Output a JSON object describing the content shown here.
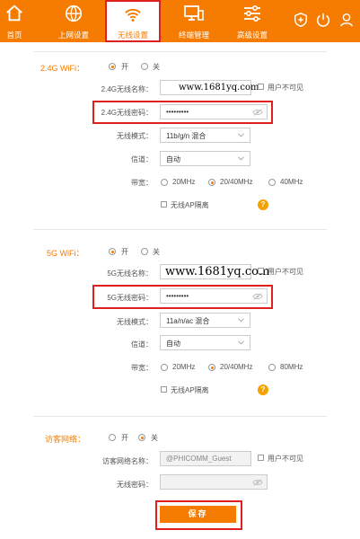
{
  "nav": {
    "items": [
      {
        "label": "首页",
        "icon": "home-icon"
      },
      {
        "label": "上网设置",
        "icon": "globe-icon"
      },
      {
        "label": "无线设置",
        "icon": "wifi-icon"
      },
      {
        "label": "终端管理",
        "icon": "devices-icon"
      },
      {
        "label": "高级设置",
        "icon": "sliders-icon"
      }
    ],
    "active": "无线设置",
    "top_icons": [
      "shield-plus-icon",
      "power-icon",
      "user-icon"
    ]
  },
  "wifi24": {
    "title": "2.4G WiFi：",
    "on_label": "开",
    "off_label": "关",
    "enabled": true,
    "name_label": "2.4G无线名称：",
    "name_value": "",
    "watermark": "www.1681yq.com",
    "hidden_label": "用户不可见",
    "pwd_label": "2.4G无线密码：",
    "pwd_value": "•••••••••",
    "mode_label": "无线模式：",
    "mode_value": "11b/g/n 混合",
    "channel_label": "信道：",
    "channel_value": "自动",
    "bw_label": "带宽：",
    "bw_options": [
      "20MHz",
      "20/40MHz",
      "40MHz"
    ],
    "bw_selected": "20/40MHz",
    "ap_isolation_label": "无线AP隔离"
  },
  "wifi5": {
    "title": "5G WiFi：",
    "on_label": "开",
    "off_label": "关",
    "enabled": true,
    "name_label": "5G无线名称：",
    "name_value": "",
    "watermark": "www.1681yq.com",
    "hidden_label": "用户不可见",
    "pwd_label": "5G无线密码：",
    "pwd_value": "•••••••••",
    "mode_label": "无线模式：",
    "mode_value": "11a/n/ac 混合",
    "channel_label": "信道：",
    "channel_value": "自动",
    "bw_label": "带宽：",
    "bw_options": [
      "20MHz",
      "20/40MHz",
      "80MHz"
    ],
    "bw_selected": "20/40MHz",
    "ap_isolation_label": "无线AP隔离"
  },
  "guest": {
    "title": "访客网络：",
    "on_label": "开",
    "off_label": "关",
    "enabled": false,
    "name_label": "访客网络名称：",
    "name_value": "@PHICOMM_Guest",
    "hidden_label": "用户不可见",
    "pwd_label": "无线密码：",
    "pwd_value": ""
  },
  "save_label": "保存",
  "colors": {
    "accent": "#f57c00",
    "highlight": "#e0201e",
    "help": "#f5a200"
  }
}
